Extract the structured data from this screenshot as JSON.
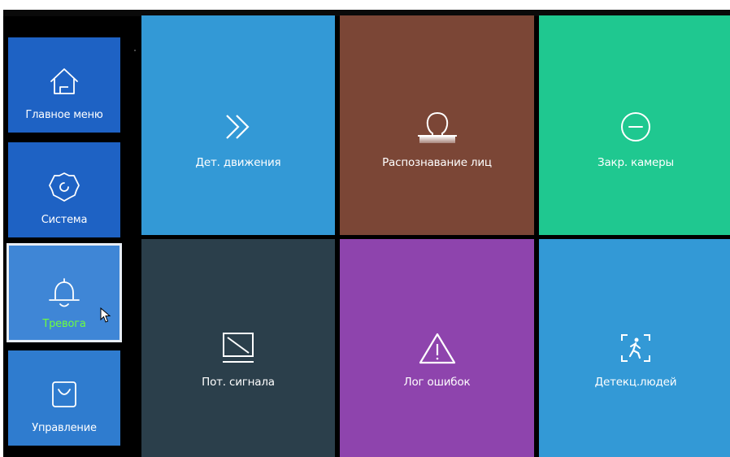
{
  "colors": {
    "screen_background": "#000000",
    "nav_tile": "#1e62c4",
    "nav_tile_selected": "#3f86d6",
    "nav_tile_manage": "#2f7ccf",
    "selected_label": "#6dff3f",
    "motion": "#3399d6",
    "face": "#7b4636",
    "tamper": "#1fc890",
    "video_loss": "#2b3f4b",
    "error_log": "#8e44ad",
    "human": "#3399d6"
  },
  "sidebar": {
    "items": [
      {
        "label": "Главное меню",
        "icon": "home-icon",
        "selected": false
      },
      {
        "label": "Система",
        "icon": "gear-icon",
        "selected": false
      },
      {
        "label": "Тревога",
        "icon": "bell-icon",
        "selected": true
      },
      {
        "label": "Управление",
        "icon": "bag-icon",
        "selected": false
      }
    ]
  },
  "tiles": [
    {
      "label": "Дет. движения",
      "icon": "double-chevron-right-icon"
    },
    {
      "label": "Распознавание лиц",
      "icon": "face-icon"
    },
    {
      "label": "Закр. камеры",
      "icon": "minus-circle-icon"
    },
    {
      "label": "Пот. сигнала",
      "icon": "signal-loss-icon"
    },
    {
      "label": "Лог ошибок",
      "icon": "warning-icon"
    },
    {
      "label": "Детекц.людей",
      "icon": "human-detect-icon"
    }
  ]
}
